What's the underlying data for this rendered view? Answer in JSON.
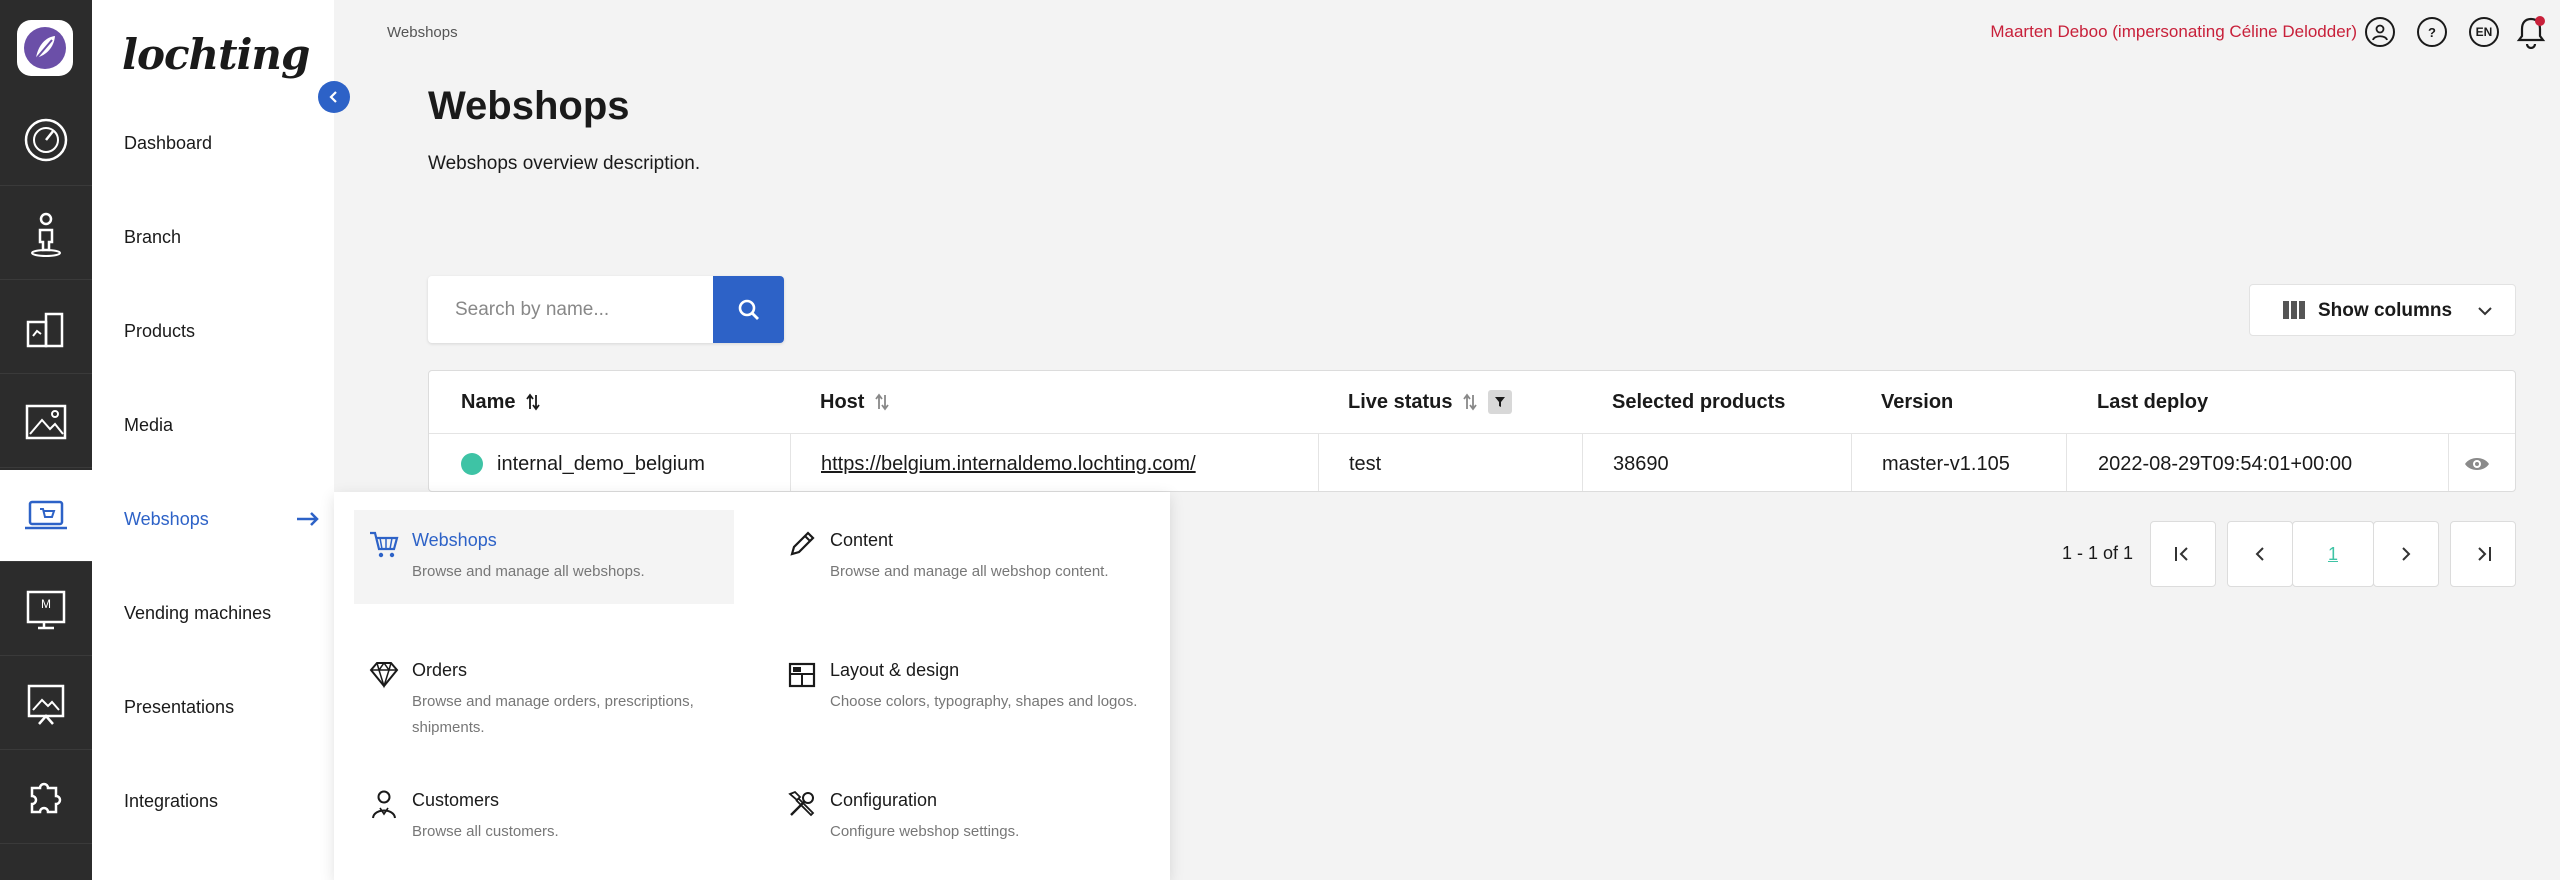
{
  "brand": "lochting",
  "breadcrumb": "Webshops",
  "header": {
    "user_text": "Maarten Deboo (impersonating Céline Delodder)",
    "language": "EN",
    "help": "?"
  },
  "nav": {
    "items": [
      {
        "label": "Dashboard"
      },
      {
        "label": "Branch"
      },
      {
        "label": "Products"
      },
      {
        "label": "Media"
      },
      {
        "label": "Webshops"
      },
      {
        "label": "Vending machines"
      },
      {
        "label": "Presentations"
      },
      {
        "label": "Integrations"
      }
    ]
  },
  "page": {
    "title": "Webshops",
    "description": "Webshops overview description."
  },
  "search": {
    "placeholder": "Search by name..."
  },
  "show_columns_label": "Show columns",
  "table": {
    "columns": [
      "Name",
      "Host",
      "Live status",
      "Selected products",
      "Version",
      "Last deploy"
    ],
    "rows": [
      {
        "name": "internal_demo_belgium",
        "host": "https://belgium.internaldemo.lochting.com/",
        "live_status": "test",
        "selected_products": "38690",
        "version": "master-v1.105",
        "last_deploy": "2022-08-29T09:54:01+00:00"
      }
    ]
  },
  "pagination": {
    "summary": "1 - 1 of 1",
    "current": "1"
  },
  "submenu": {
    "items": [
      {
        "title": "Webshops",
        "desc": "Browse and manage all webshops."
      },
      {
        "title": "Content",
        "desc": "Browse and manage all webshop content."
      },
      {
        "title": "Orders",
        "desc": "Browse and manage orders, prescriptions, shipments."
      },
      {
        "title": "Layout & design",
        "desc": "Choose colors, typography, shapes and logos."
      },
      {
        "title": "Customers",
        "desc": "Browse all customers."
      },
      {
        "title": "Configuration",
        "desc": "Configure webshop settings."
      }
    ]
  },
  "colors": {
    "accent": "#2d62c7",
    "rail": "#2c2c2c",
    "user": "#c8203a",
    "status_live": "#3ec3a5"
  }
}
